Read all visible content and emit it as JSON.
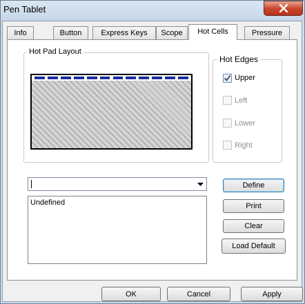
{
  "window": {
    "title": "Pen Tablet"
  },
  "tabs": [
    {
      "label": "Info"
    },
    {
      "label": "Button"
    },
    {
      "label": "Express Keys"
    },
    {
      "label": "Scope"
    },
    {
      "label": "Hot Cells",
      "active": true
    },
    {
      "label": "Pressure"
    }
  ],
  "hot_pad": {
    "legend": "Hot Pad Layout",
    "cell_count": 12,
    "cell_color": "#1a2e9e"
  },
  "hot_edges": {
    "legend": "Hot Edges",
    "items": [
      {
        "label": "Upper",
        "checked": true,
        "enabled": true
      },
      {
        "label": "Left",
        "checked": false,
        "enabled": false
      },
      {
        "label": "Lower",
        "checked": false,
        "enabled": false
      },
      {
        "label": "Right",
        "checked": false,
        "enabled": false
      }
    ]
  },
  "cell_combo": {
    "value": ""
  },
  "cell_list": {
    "items": [
      "Undefined"
    ]
  },
  "side_buttons": {
    "define": "Define",
    "print": "Print",
    "clear": "Clear",
    "load_default": "Load Default"
  },
  "footer": {
    "ok": "OK",
    "cancel": "Cancel",
    "apply": "Apply"
  }
}
